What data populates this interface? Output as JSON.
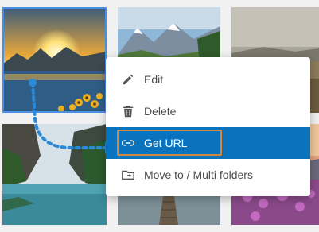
{
  "gallery": {
    "tiles": [
      {
        "name": "sunset-lake-photo"
      },
      {
        "name": "mountain-valley-photo"
      },
      {
        "name": "misty-field-photo"
      },
      {
        "name": "canyon-lake-photo"
      },
      {
        "name": "pier-photo"
      },
      {
        "name": "flower-field-photo"
      }
    ]
  },
  "context_menu": {
    "items": [
      {
        "label": "Edit",
        "icon": "pencil-icon"
      },
      {
        "label": "Delete",
        "icon": "trash-icon"
      },
      {
        "label": "Get URL",
        "icon": "link-icon",
        "highlighted": true
      },
      {
        "label": "Move to / Multi folders",
        "icon": "folder-move-icon"
      }
    ],
    "accent": "#0a73c0",
    "annotation_color": "#d2893f",
    "pointer_color": "#2b8ad8"
  }
}
